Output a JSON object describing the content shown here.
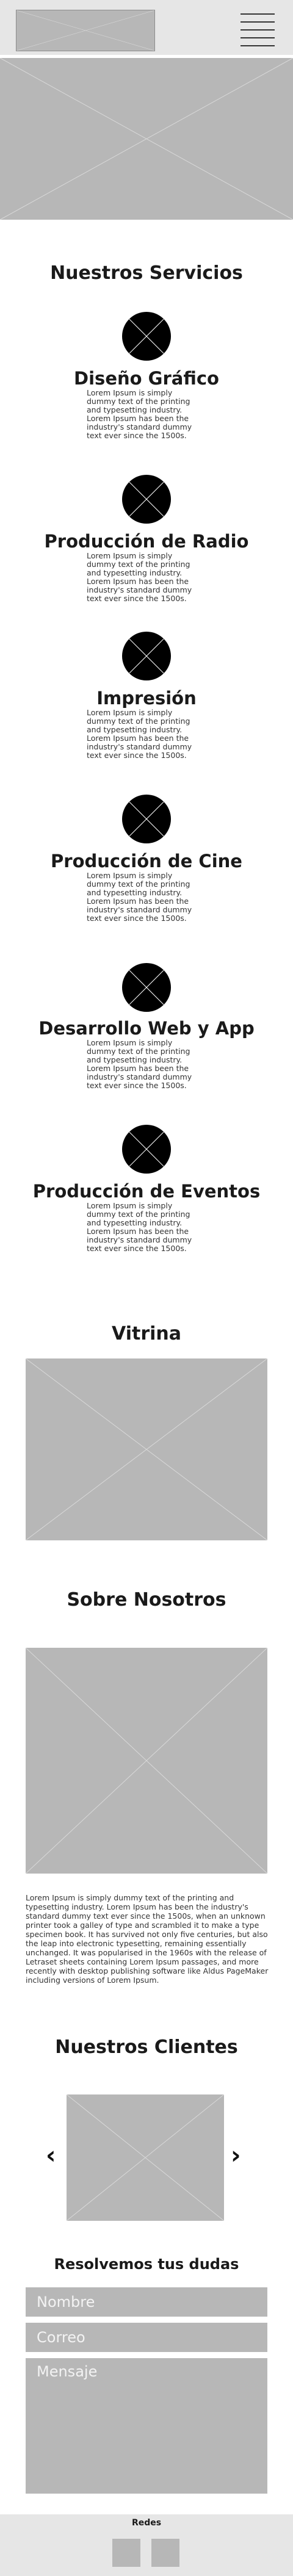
{
  "services": {
    "title": "Nuestros Servicios",
    "items": [
      {
        "title": "Diseño Gráfico",
        "text": "Lorem Ipsum is simply dummy text of the printing and typesetting industry. Lorem Ipsum has been the industry's standard dummy text ever since the 1500s."
      },
      {
        "title": "Producción de Radio",
        "text": "Lorem Ipsum is simply dummy text of the printing and typesetting industry. Lorem Ipsum has been the industry's standard dummy text ever since the 1500s."
      },
      {
        "title": "Impresión",
        "text": "Lorem Ipsum is simply dummy text of the printing and typesetting industry. Lorem Ipsum has been the industry's standard dummy text ever since the 1500s."
      },
      {
        "title": "Producción de Cine",
        "text": "Lorem Ipsum is simply dummy text of the printing and typesetting industry. Lorem Ipsum has been the industry's standard dummy text ever since the 1500s."
      },
      {
        "title": "Desarrollo Web y App",
        "text": "Lorem Ipsum is simply dummy text of the printing and typesetting industry. Lorem Ipsum has been the industry's standard dummy text ever since the 1500s."
      },
      {
        "title": "Producción de Eventos",
        "text": "Lorem Ipsum is simply dummy text of the printing and typesetting industry. Lorem Ipsum has been the industry's standard dummy text ever since the 1500s."
      }
    ]
  },
  "showcase": {
    "title": "Vitrina"
  },
  "about": {
    "title": "Sobre Nosotros",
    "text": "Lorem Ipsum is simply dummy text of the printing and typesetting industry. Lorem Ipsum has been the industry's standard dummy text ever since the 1500s, when an unknown printer took a galley of type and scrambled it to make a type specimen book. It has survived not only five centuries, but also the leap into electronic typesetting, remaining essentially unchanged. It was popularised in the 1960s with the release of Letraset sheets containing Lorem Ipsum passages, and more recently with desktop publishing software like Aldus PageMaker including versions of Lorem Ipsum."
  },
  "clients": {
    "title": "Nuestros Clientes",
    "prev": "‹",
    "next": "›"
  },
  "contact": {
    "title": "Resolvemos tus dudas",
    "name_placeholder": "Nombre",
    "email_placeholder": "Correo",
    "message_placeholder": "Mensaje"
  },
  "footer": {
    "title": "Redes"
  }
}
